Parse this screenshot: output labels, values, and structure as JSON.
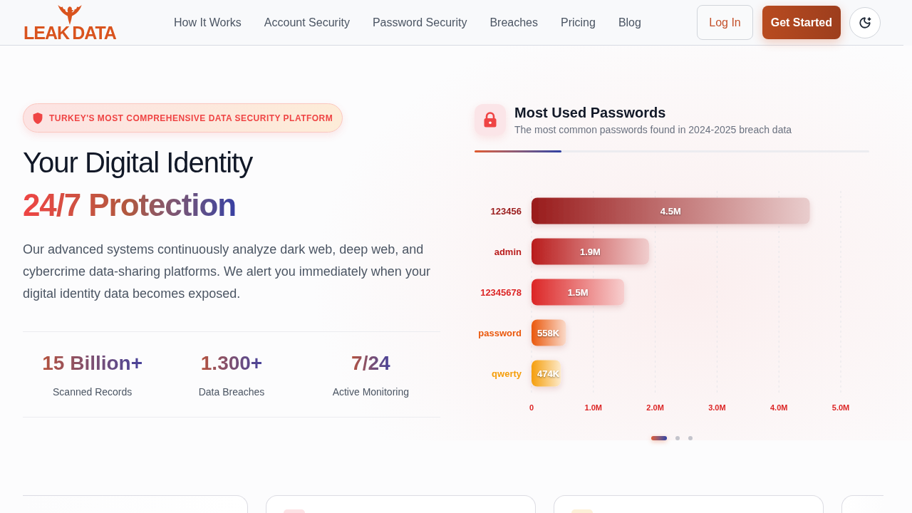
{
  "header": {
    "logo": {
      "left": "LEAK",
      "right": "DATA"
    },
    "nav": [
      "How It Works",
      "Account Security",
      "Password Security",
      "Breaches",
      "Pricing",
      "Blog"
    ],
    "login_button": "Log In",
    "cta_button": "Get Started"
  },
  "hero": {
    "badge": "TURKEY'S MOST COMPREHENSIVE DATA SECURITY PLATFORM",
    "heading": "Your Digital Identity",
    "highlight": "24/7 Protection",
    "description": "Our advanced systems continuously analyze dark web, deep web, and cybercrime data-sharing platforms. We alert you immediately when your digital identity data becomes exposed.",
    "stats": [
      {
        "value": "15 Billion+",
        "label": "Scanned Records"
      },
      {
        "value": "1.300+",
        "label": "Data Breaches"
      },
      {
        "value": "7/24",
        "label": "Active Monitoring"
      }
    ]
  },
  "passwords_card": {
    "title": "Most Used Passwords",
    "subtitle": "The most common passwords found in 2024-2025 breach data",
    "progress": {
      "level": 0.22
    },
    "chart_data": {
      "type": "bar",
      "orientation": "horizontal",
      "categories": [
        "123456",
        "admin",
        "12345678",
        "password",
        "qwerty"
      ],
      "values": [
        4500000,
        1900000,
        1500000,
        558000,
        474000
      ],
      "value_labels": [
        "4.5M",
        "1.9M",
        "1.5M",
        "558K",
        "474K"
      ],
      "colors": [
        "#991b1b",
        "#b91c1c",
        "#dc2626",
        "#ea580c",
        "#f59e0b"
      ],
      "grid": true,
      "xlim": [
        0,
        5000000
      ],
      "xticks": [
        {
          "value": 0,
          "label": "0"
        },
        {
          "value": 1000000,
          "label": "1.0M"
        },
        {
          "value": 2000000,
          "label": "2.0M"
        },
        {
          "value": 3000000,
          "label": "3.0M"
        },
        {
          "value": 4000000,
          "label": "4.0M"
        },
        {
          "value": 5000000,
          "label": "5.0M"
        }
      ]
    },
    "slides": [
      {
        "selected": true
      },
      {
        "selected": false
      },
      {
        "selected": false
      }
    ]
  },
  "feature_cards": [
    {
      "tile": false
    },
    {
      "tile": true,
      "color": "#fde2e5"
    },
    {
      "tile": true,
      "color": "#fdf0d8"
    },
    {
      "tile": false
    }
  ]
}
